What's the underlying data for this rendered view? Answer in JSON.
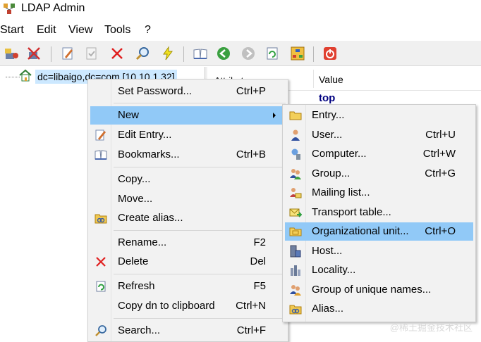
{
  "window": {
    "title": "LDAP Admin"
  },
  "menubar": {
    "items": [
      "Start",
      "Edit",
      "View",
      "Tools",
      "?"
    ]
  },
  "toolbar": {
    "icons": [
      "connect-icon",
      "disconnect-icon",
      "edit-icon",
      "check-icon",
      "delete-icon",
      "search-icon",
      "lightning-icon",
      "bookmarks-icon",
      "back-icon",
      "forward-icon",
      "refresh-icon",
      "schema-icon",
      "exit-icon"
    ]
  },
  "tree": {
    "root_label": "dc=libaigo,dc=com [10.10.1.32]"
  },
  "grid": {
    "col_attribute": "Attribute",
    "col_value": "Value",
    "first_value": "top"
  },
  "context_menu": {
    "items": [
      {
        "label": "Set Password...",
        "shortcut": "Ctrl+P",
        "icon": ""
      },
      {
        "label": "New",
        "shortcut": "",
        "icon": "",
        "submenu": true,
        "highlighted": true
      },
      {
        "label": "Edit Entry...",
        "shortcut": "",
        "icon": "edit-icon"
      },
      {
        "label": "Bookmarks...",
        "shortcut": "Ctrl+B",
        "icon": "bookmarks-icon"
      },
      {
        "label": "Copy...",
        "shortcut": "",
        "icon": ""
      },
      {
        "label": "Move...",
        "shortcut": "",
        "icon": ""
      },
      {
        "label": "Create alias...",
        "shortcut": "",
        "icon": "alias-icon"
      },
      {
        "label": "Rename...",
        "shortcut": "F2",
        "icon": ""
      },
      {
        "label": "Delete",
        "shortcut": "Del",
        "icon": "delete-icon"
      },
      {
        "label": "Refresh",
        "shortcut": "F5",
        "icon": "refresh-icon"
      },
      {
        "label": "Copy dn to clipboard",
        "shortcut": "Ctrl+N",
        "icon": ""
      },
      {
        "label": "Search...",
        "shortcut": "Ctrl+F",
        "icon": "search-icon"
      }
    ]
  },
  "submenu": {
    "items": [
      {
        "label": "Entry...",
        "shortcut": "",
        "icon": "folder-icon"
      },
      {
        "label": "User...",
        "shortcut": "Ctrl+U",
        "icon": "user-icon"
      },
      {
        "label": "Computer...",
        "shortcut": "Ctrl+W",
        "icon": "computer-icon"
      },
      {
        "label": "Group...",
        "shortcut": "Ctrl+G",
        "icon": "group-icon"
      },
      {
        "label": "Mailing list...",
        "shortcut": "",
        "icon": "mailing-list-icon"
      },
      {
        "label": "Transport table...",
        "shortcut": "",
        "icon": "transport-icon"
      },
      {
        "label": "Organizational unit...",
        "shortcut": "Ctrl+O",
        "icon": "ou-folder-icon",
        "highlighted": true
      },
      {
        "label": "Host...",
        "shortcut": "",
        "icon": "host-icon"
      },
      {
        "label": "Locality...",
        "shortcut": "",
        "icon": "locality-icon"
      },
      {
        "label": "Group of unique names...",
        "shortcut": "",
        "icon": "unique-group-icon"
      },
      {
        "label": "Alias...",
        "shortcut": "",
        "icon": "alias-icon"
      }
    ]
  },
  "watermark": "@稀土掘金技术社区",
  "colors": {
    "highlight": "#91c9f7",
    "menu_bg": "#f2f2f2",
    "tree_selection": "#cce8ff"
  }
}
